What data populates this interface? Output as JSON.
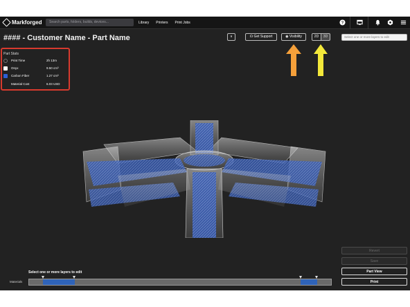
{
  "nav": {
    "brand": "Markforged",
    "search_placeholder": "Search parts, folders, builds, devices...",
    "links": [
      "Library",
      "Printers",
      "Print Jobs"
    ],
    "icons": [
      "help-icon",
      "monitor-icon",
      "bell-icon",
      "settings-icon",
      "menu-icon"
    ]
  },
  "page": {
    "title": "#### - Customer Name - Part Name"
  },
  "toolbar": {
    "collapse_label": "∨",
    "support_label": "Get Support",
    "visibility_label": "Visibility",
    "view_2d": "2D",
    "view_3d": "3D",
    "layer_select_placeholder": "Select one or more layers to edit"
  },
  "part_stats": {
    "title": "Part Stats",
    "rows": [
      {
        "label": "Print Time",
        "value": "2h 13m",
        "swatch": "none"
      },
      {
        "label": "Onyx",
        "value": "9.50 cm³",
        "swatch": "#ffffff"
      },
      {
        "label": "Carbon Fiber",
        "value": "1.27 cm³",
        "swatch": "#2d5fd6"
      },
      {
        "label": "Material Cost",
        "value": "6.03 USD",
        "swatch": "none"
      }
    ]
  },
  "actions": {
    "revert": "Revert",
    "save": "Save",
    "part_view": "Part View",
    "print": "Print"
  },
  "timeline": {
    "hint": "Select one or more layers to edit",
    "label": "Materials"
  },
  "colors": {
    "accent_blue": "#2d5fd6",
    "highlight_red": "#d83a2e",
    "arrow_orange": "#f5a03a",
    "arrow_yellow": "#f3e83a"
  }
}
